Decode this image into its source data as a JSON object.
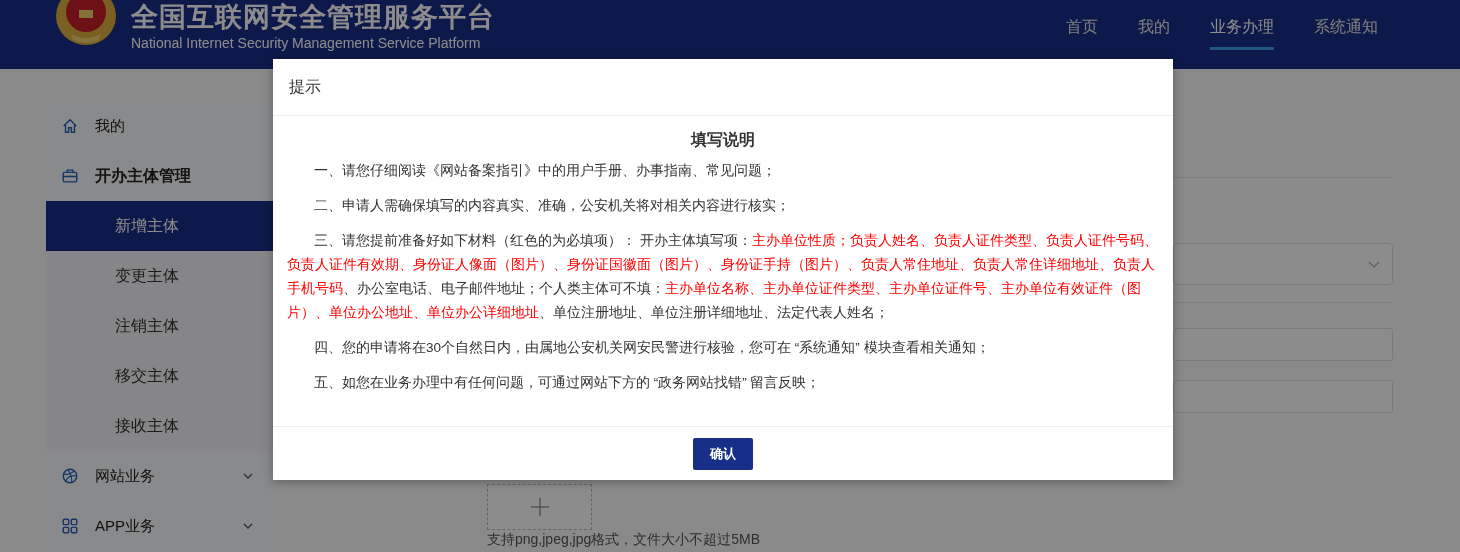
{
  "header": {
    "title": "全国互联网安全管理服务平台",
    "subtitle": "National Internet Security Management Service Platform",
    "nav": [
      {
        "label": "首页",
        "selected": false
      },
      {
        "label": "我的",
        "selected": false
      },
      {
        "label": "业务办理",
        "selected": true
      },
      {
        "label": "系统通知",
        "selected": false
      }
    ]
  },
  "sidebar": {
    "items": [
      {
        "label": "我的",
        "bold": false,
        "chevron": false
      },
      {
        "label": "开办主体管理",
        "bold": true,
        "chevron": false,
        "children": [
          {
            "label": "新增主体",
            "selected": true
          },
          {
            "label": "变更主体",
            "selected": false
          },
          {
            "label": "注销主体",
            "selected": false
          },
          {
            "label": "移交主体",
            "selected": false
          },
          {
            "label": "接收主体",
            "selected": false
          }
        ]
      },
      {
        "label": "网站业务",
        "bold": false,
        "chevron": true
      },
      {
        "label": "APP业务",
        "bold": false,
        "chevron": true
      }
    ]
  },
  "form": {
    "upload_hint": "支持png,jpeg,jpg格式，文件大小不超过5MB"
  },
  "dialog": {
    "title": "提示",
    "heading": "填写说明",
    "paragraphs": [
      [
        {
          "text": "一、请您仔细阅读《网站备案指引》中的用户手册、办事指南、常见问题；",
          "required": false
        }
      ],
      [
        {
          "text": "二、申请人需确保填写的内容真实、准确，公安机关将对相关内容进行核实；",
          "required": false
        }
      ],
      [
        {
          "text": "三、请您提前准备好如下材料（红色的为必填项）： 开办主体填写项：",
          "required": false
        },
        {
          "text": "主办单位性质；负责人姓名、负责人证件类型、负责人证件号码、负责人证件有效期、身份证人像面（图片）、身份证国徽面（图片）、身份证手持（图片）、负责人常住地址、负责人常住详细地址、负责人手机号码",
          "required": true
        },
        {
          "text": "、办公室电话、电子邮件地址；个人类主体可不填：",
          "required": false
        },
        {
          "text": "主办单位名称、主办单位证件类型、主办单位证件号、主办单位有效证件（图片）、单位办公地址、单位办公详细地址",
          "required": true
        },
        {
          "text": "、单位注册地址、单位注册详细地址、法定代表人姓名；",
          "required": false
        }
      ],
      [
        {
          "text": "四、您的申请将在30个自然日内，由属地公安机关网安民警进行核验，您可在 “系统通知” 模块查看相关通知；",
          "required": false
        }
      ],
      [
        {
          "text": "五、如您在业务办理中有任何问题，可通过网站下方的 “政务网站找错” 留言反映；",
          "required": false
        }
      ]
    ],
    "confirm": "确认"
  }
}
